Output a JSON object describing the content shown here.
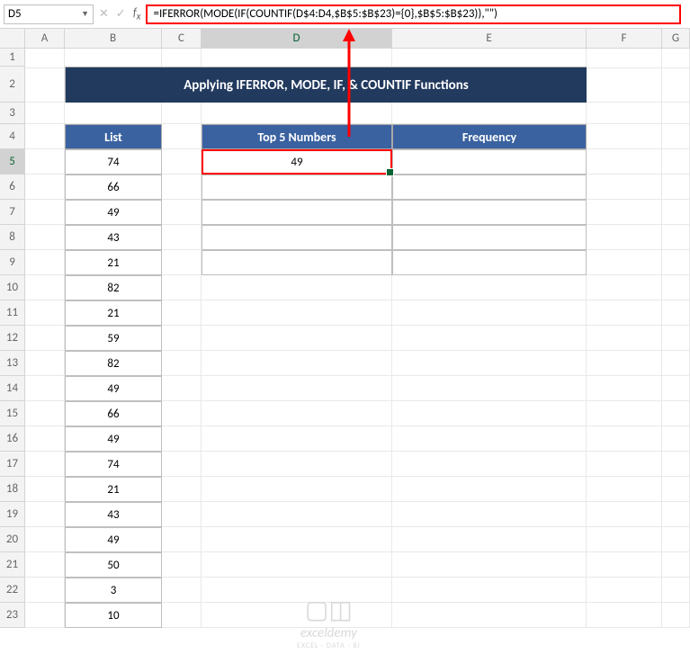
{
  "name_box": "D5",
  "formula": "=IFERROR(MODE(IF(COUNTIF(D$4:D4,$B$5:$B$23)={0},$B$5:$B$23)),\"\")",
  "columns": [
    "A",
    "B",
    "C",
    "D",
    "E",
    "F",
    "G"
  ],
  "rows": [
    "1",
    "2",
    "3",
    "4",
    "5",
    "6",
    "7",
    "8",
    "9",
    "10",
    "11",
    "12",
    "13",
    "14",
    "15",
    "16",
    "17",
    "18",
    "19",
    "20",
    "21",
    "22",
    "23"
  ],
  "title": "Applying IFERROR, MODE, IF, & COUNTIF Functions",
  "headers": {
    "list": "List",
    "top5": "Top 5 Numbers",
    "freq": "Frequency"
  },
  "list_values": [
    "74",
    "66",
    "49",
    "43",
    "21",
    "82",
    "21",
    "59",
    "82",
    "49",
    "66",
    "49",
    "74",
    "21",
    "43",
    "49",
    "50",
    "3",
    "10"
  ],
  "d5_value": "49",
  "watermark": {
    "brand": "exceldemy",
    "sub": "EXCEL · DATA · BI"
  },
  "chart_data": {
    "type": "table"
  }
}
